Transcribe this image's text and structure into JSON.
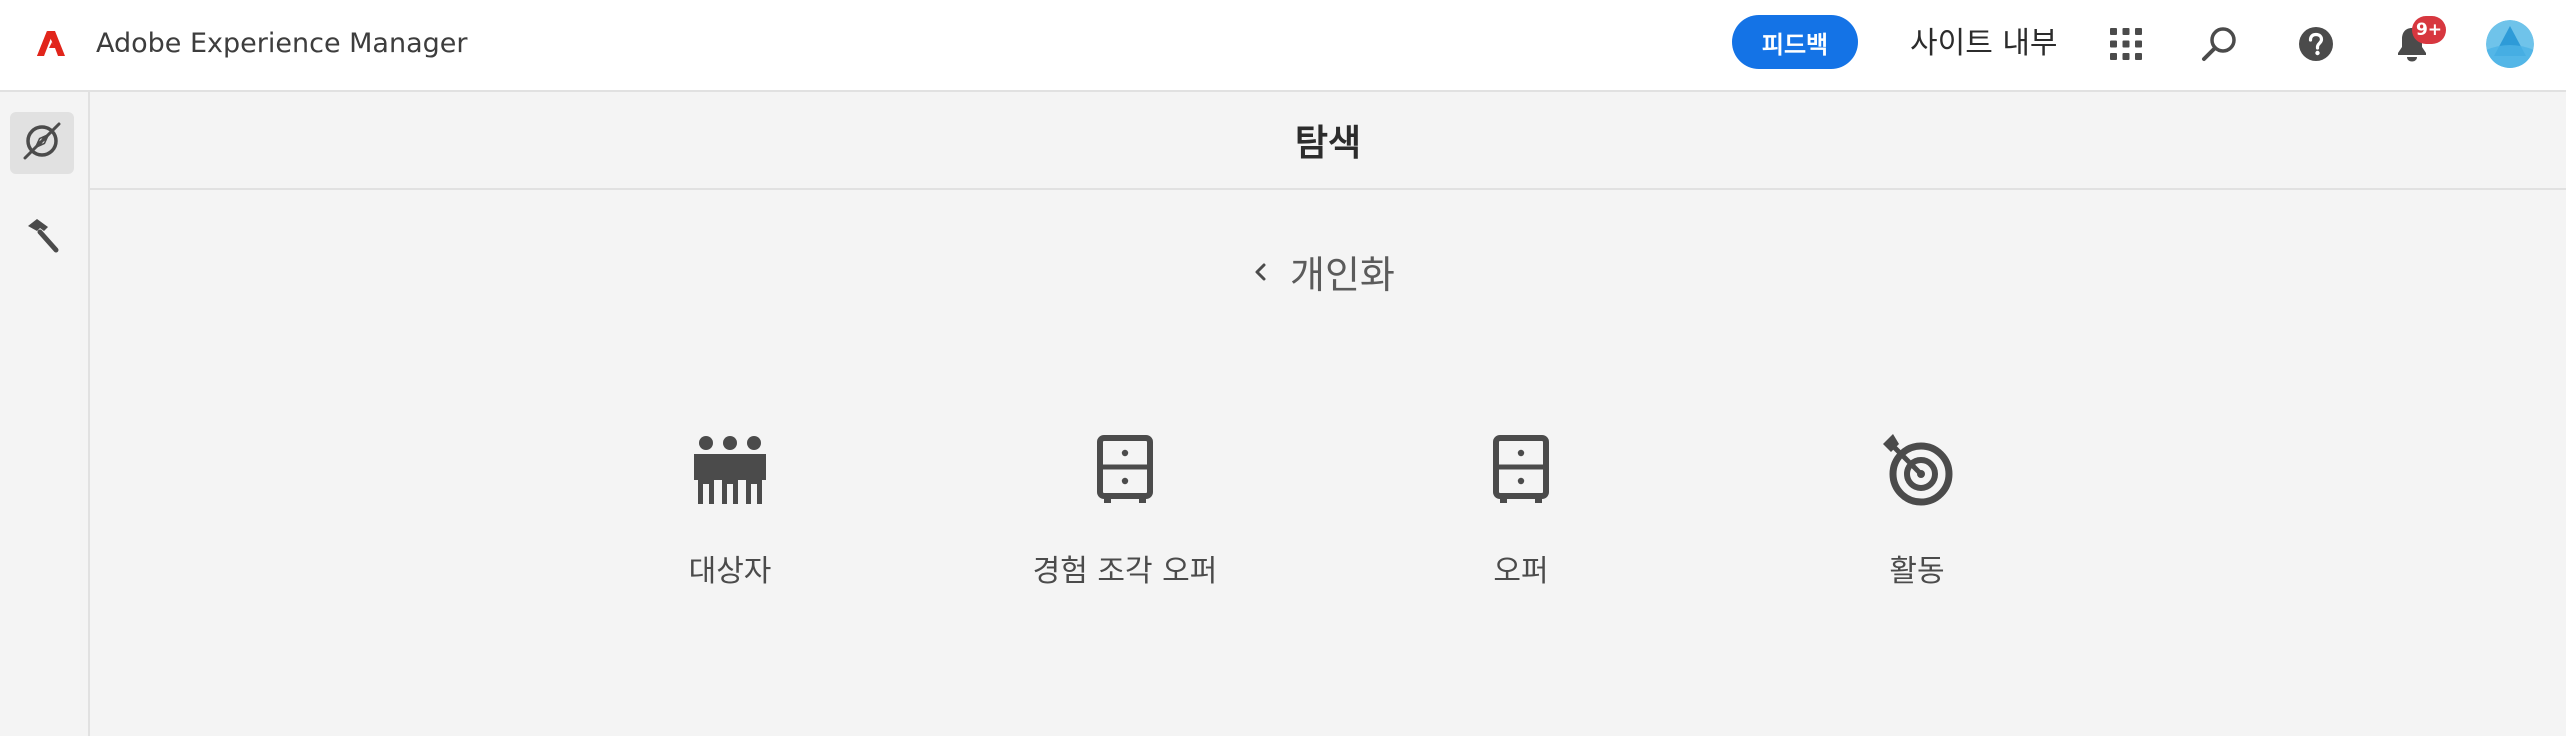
{
  "header": {
    "app_title": "Adobe Experience Manager",
    "feedback_label": "피드백",
    "site_internal_label": "사이트 내부",
    "notification_badge": "9+",
    "icons": [
      "adobe-logo",
      "apps-grid-icon",
      "search-icon",
      "help-icon",
      "bell-icon",
      "avatar"
    ]
  },
  "rail": {
    "items": [
      {
        "name": "navigation",
        "icon": "compass-icon",
        "active": true
      },
      {
        "name": "tools",
        "icon": "hammer-icon",
        "active": false
      }
    ]
  },
  "main": {
    "title": "탐색",
    "breadcrumb": "개인화",
    "tiles": [
      {
        "label": "대상자",
        "icon": "audience-icon"
      },
      {
        "label": "경험 조각 오퍼",
        "icon": "cabinet-icon"
      },
      {
        "label": "오퍼",
        "icon": "cabinet-icon"
      },
      {
        "label": "활동",
        "icon": "target-icon"
      }
    ]
  },
  "colors": {
    "accent": "#1473e6",
    "badge": "#d7373f",
    "background": "#f4f4f4",
    "icon": "#4b4b4b"
  }
}
